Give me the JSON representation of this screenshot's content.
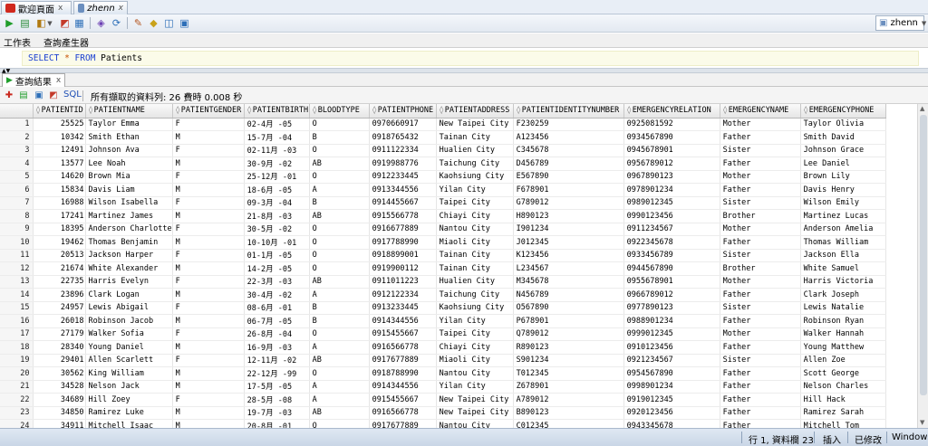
{
  "doc_tabs": [
    {
      "label": "歡迎頁面",
      "close": "x",
      "icon_color": "#d0281e"
    },
    {
      "label": "zhenn",
      "close": "x",
      "icon_color": "#6b8fbf"
    }
  ],
  "connection": {
    "label": "zhenn"
  },
  "editor_tabs": [
    "工作表",
    "查詢產生器"
  ],
  "sql": {
    "select": "SELECT",
    "star": "*",
    "from": "FROM",
    "table": "Patients"
  },
  "results": {
    "tab_label": "查詢結果",
    "tab_close": "x",
    "sql_label": "SQL",
    "fetch_message": "所有擷取的資料列: 26 費時 0.008 秒"
  },
  "grid": {
    "columns": [
      "PATIENTID",
      "PATIENTNAME",
      "PATIENTGENDER",
      "PATIENTBIRTH",
      "BLOODTYPE",
      "PATIENTPHONE",
      "PATIENTADDRESS",
      "PATIENTIDENTITYNUMBER",
      "EMERGENCYRELATION",
      "EMERGENCYNAME",
      "EMERGENCYPHONE"
    ],
    "rows": [
      [
        "1",
        "25525",
        "Taylor Emma",
        "F",
        "02-4月 -05",
        "O",
        "0970660917",
        "New Taipei City",
        "F230259",
        "0925081592",
        "Mother",
        "Taylor Olivia"
      ],
      [
        "2",
        "10342",
        "Smith Ethan",
        "M",
        "15-7月 -04",
        "B",
        "0918765432",
        "Tainan City",
        "A123456",
        "0934567890",
        "Father",
        "Smith David"
      ],
      [
        "3",
        "12491",
        "Johnson Ava",
        "F",
        "02-11月 -03",
        "O",
        "0911122334",
        "Hualien City",
        "C345678",
        "0945678901",
        "Sister",
        "Johnson Grace"
      ],
      [
        "4",
        "13577",
        "Lee Noah",
        "M",
        "30-9月 -02",
        "AB",
        "0919988776",
        "Taichung City",
        "D456789",
        "0956789012",
        "Father",
        "Lee Daniel"
      ],
      [
        "5",
        "14620",
        "Brown Mia",
        "F",
        "25-12月 -01",
        "O",
        "0912233445",
        "Kaohsiung City",
        "E567890",
        "0967890123",
        "Mother",
        "Brown Lily"
      ],
      [
        "6",
        "15834",
        "Davis Liam",
        "M",
        "18-6月 -05",
        "A",
        "0913344556",
        "Yilan City",
        "F678901",
        "0978901234",
        "Father",
        "Davis Henry"
      ],
      [
        "7",
        "16988",
        "Wilson Isabella",
        "F",
        "09-3月 -04",
        "B",
        "0914455667",
        "Taipei City",
        "G789012",
        "0989012345",
        "Sister",
        "Wilson Emily"
      ],
      [
        "8",
        "17241",
        "Martinez James",
        "M",
        "21-8月 -03",
        "AB",
        "0915566778",
        "Chiayi City",
        "H890123",
        "0990123456",
        "Brother",
        "Martinez Lucas"
      ],
      [
        "9",
        "18395",
        "Anderson Charlotte",
        "F",
        "30-5月 -02",
        "O",
        "0916677889",
        "Nantou City",
        "I901234",
        "0911234567",
        "Mother",
        "Anderson Amelia"
      ],
      [
        "10",
        "19462",
        "Thomas Benjamin",
        "M",
        "10-10月 -01",
        "O",
        "0917788990",
        "Miaoli City",
        "J012345",
        "0922345678",
        "Father",
        "Thomas William"
      ],
      [
        "11",
        "20513",
        "Jackson Harper",
        "F",
        "01-1月 -05",
        "O",
        "0918899001",
        "Tainan City",
        "K123456",
        "0933456789",
        "Sister",
        "Jackson Ella"
      ],
      [
        "12",
        "21674",
        "White Alexander",
        "M",
        "14-2月 -05",
        "O",
        "0919900112",
        "Tainan City",
        "L234567",
        "0944567890",
        "Brother",
        "White Samuel"
      ],
      [
        "13",
        "22735",
        "Harris Evelyn",
        "F",
        "22-3月 -03",
        "AB",
        "0911011223",
        "Hualien City",
        "M345678",
        "0955678901",
        "Mother",
        "Harris Victoria"
      ],
      [
        "14",
        "23896",
        "Clark Logan",
        "M",
        "30-4月 -02",
        "A",
        "0912122334",
        "Taichung City",
        "N456789",
        "0966789012",
        "Father",
        "Clark Joseph"
      ],
      [
        "15",
        "24957",
        "Lewis Abigail",
        "F",
        "08-6月 -01",
        "B",
        "0913233445",
        "Kaohsiung City",
        "O567890",
        "0977890123",
        "Sister",
        "Lewis Natalie"
      ],
      [
        "16",
        "26018",
        "Robinson Jacob",
        "M",
        "06-7月 -05",
        "B",
        "0914344556",
        "Yilan City",
        "P678901",
        "0988901234",
        "Father",
        "Robinson Ryan"
      ],
      [
        "17",
        "27179",
        "Walker Sofia",
        "F",
        "26-8月 -04",
        "O",
        "0915455667",
        "Taipei City",
        "Q789012",
        "0999012345",
        "Mother",
        "Walker Hannah"
      ],
      [
        "18",
        "28340",
        "Young Daniel",
        "M",
        "16-9月 -03",
        "A",
        "0916566778",
        "Chiayi City",
        "R890123",
        "0910123456",
        "Father",
        "Young Matthew"
      ],
      [
        "19",
        "29401",
        "Allen Scarlett",
        "F",
        "12-11月 -02",
        "AB",
        "0917677889",
        "Miaoli City",
        "S901234",
        "0921234567",
        "Sister",
        "Allen Zoe"
      ],
      [
        "20",
        "30562",
        "King William",
        "M",
        "22-12月 -99",
        "O",
        "0918788990",
        "Nantou City",
        "T012345",
        "0954567890",
        "Father",
        "Scott George"
      ],
      [
        "21",
        "34528",
        "Nelson Jack",
        "M",
        "17-5月 -05",
        "A",
        "0914344556",
        "Yilan City",
        "Z678901",
        "0998901234",
        "Father",
        "Nelson Charles"
      ],
      [
        "22",
        "34689",
        "Hill Zoey",
        "F",
        "28-5月 -08",
        "A",
        "0915455667",
        "New Taipei City",
        "A789012",
        "0919012345",
        "Father",
        "Hill Hack"
      ],
      [
        "23",
        "34850",
        "Ramirez Luke",
        "M",
        "19-7月 -03",
        "AB",
        "0916566778",
        "New Taipei City",
        "B890123",
        "0920123456",
        "Father",
        "Ramirez Sarah"
      ],
      [
        "24",
        "34911",
        "Mitchell Isaac",
        "M",
        "20-8月 -01",
        "O",
        "0917677889",
        "Nantou City",
        "C012345",
        "0943345678",
        "Father",
        "Mitchell Tom"
      ]
    ]
  },
  "status": {
    "position": "行 1, 資料欄 23",
    "insert": "插入",
    "modified": "已修改",
    "os": "Windows: CI"
  }
}
